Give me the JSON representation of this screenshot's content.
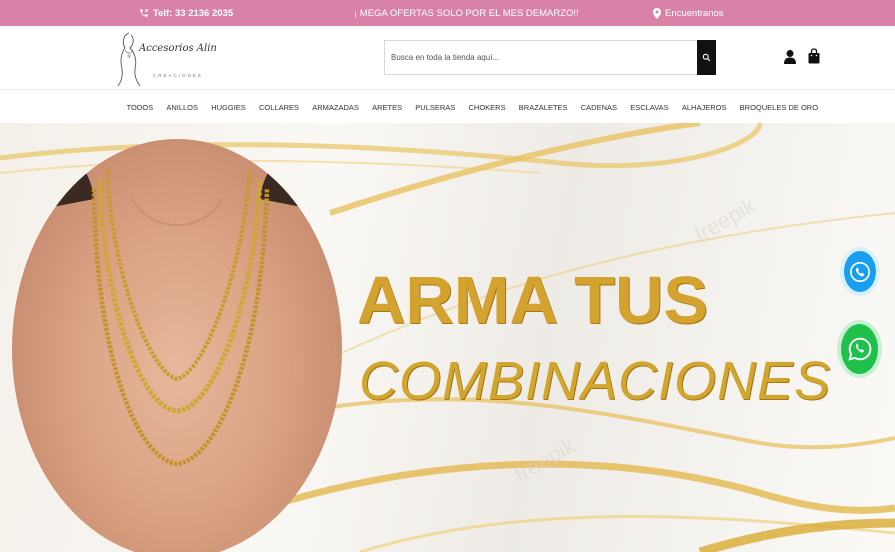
{
  "topbar": {
    "phone": "Telf: 33 2136 2035",
    "promo": "¡ MEGA OFERTAS SOLO POR EL MES DEMARZO!!",
    "location": "Encuentranos",
    "phone_icon": "phone-icon",
    "location_icon": "map-pin-icon",
    "colors": {
      "background": "#d982a8",
      "text": "#ffffff"
    }
  },
  "header": {
    "logo_text": "Accesorios Alin",
    "logo_sub": "CREACIONES",
    "search": {
      "placeholder": "Busca en toda la tienda aquí...",
      "value": ""
    },
    "search_icon": "search-icon",
    "account_icon": "user-icon",
    "cart_icon": "shopping-bag-icon"
  },
  "nav": {
    "items": [
      {
        "label": "Todos"
      },
      {
        "label": "Anillos"
      },
      {
        "label": "Huggies"
      },
      {
        "label": "Collares"
      },
      {
        "label": "Armazadas"
      },
      {
        "label": "Aretes"
      },
      {
        "label": "Pulseras"
      },
      {
        "label": "Chokers"
      },
      {
        "label": "Brazaletes"
      },
      {
        "label": "Cadenas"
      },
      {
        "label": "Esclavas"
      },
      {
        "label": "Alhajeros"
      },
      {
        "label": "Broqueles de oro"
      }
    ]
  },
  "hero": {
    "title": "ARMA TUS",
    "subtitle": "COMBINACIONES",
    "watermark": "freepik",
    "colors": {
      "gold": "#d4a22f"
    }
  },
  "floating": {
    "call_icon": "phone-call-icon",
    "whatsapp_icon": "whatsapp-icon",
    "colors": {
      "call": "#1a9ff0",
      "whatsapp": "#1fc14b"
    }
  }
}
